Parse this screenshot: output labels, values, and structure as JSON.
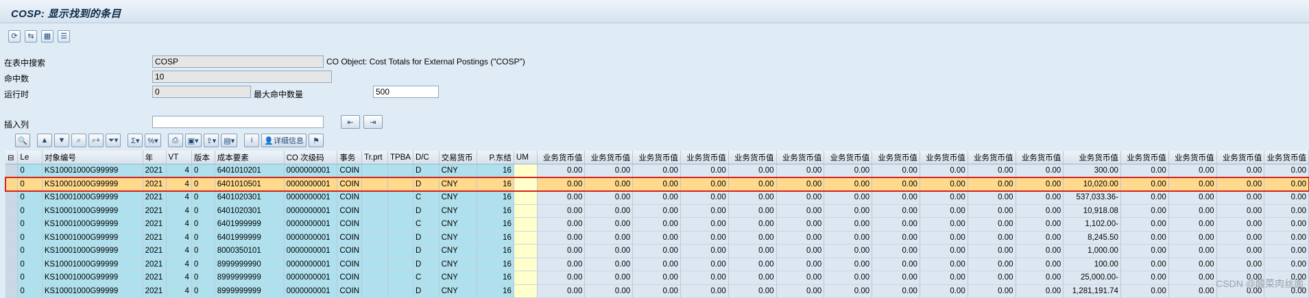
{
  "title": "COSP: 显示找到的条目",
  "toolbar_icons": [
    "refresh-icon",
    "split-icon",
    "table-icon",
    "list-icon"
  ],
  "form": {
    "search_label": "在表中搜索",
    "search_value": "COSP",
    "search_desc": "CO Object: Cost Totals for External Postings (\"COSP\")",
    "hits_label": "命中数",
    "hits_value": "10",
    "runtime_label": "运行时",
    "runtime_value": "0",
    "max_hits_label": "最大命中数量",
    "max_hits_value": "500",
    "insert_col_label": "插入列",
    "insert_col_value": ""
  },
  "alv_toolbar": {
    "detail_label": "详细信息"
  },
  "columns": [
    "Le",
    "对象编号",
    "年",
    "VT",
    "版本",
    "成本要素",
    "CO 次级码",
    "事务",
    "Tr.prt",
    "TPBA",
    "D/C",
    "交易货币",
    "P.东结",
    "UM",
    "业务货币值",
    "业务货币值",
    "业务货币值",
    "业务货币值",
    "业务货币值",
    "业务货币值",
    "业务货币值",
    "业务货币值",
    "业务货币值",
    "业务货币值",
    "业务货币值",
    "业务货币值",
    "业务货币值",
    "业务货币值",
    "业务货币值",
    "业务货币值"
  ],
  "rows": [
    [
      "0",
      "KS10001000G99999",
      "2021",
      "4",
      "0",
      "6401010201",
      "0000000001",
      "COIN",
      "",
      "",
      "D",
      "CNY",
      "16",
      "",
      "0.00",
      "0.00",
      "0.00",
      "0.00",
      "0.00",
      "0.00",
      "0.00",
      "0.00",
      "0.00",
      "0.00",
      "0.00",
      "300.00",
      "0.00",
      "0.00",
      "0.00",
      "0.00"
    ],
    [
      "0",
      "KS10001000G99999",
      "2021",
      "4",
      "0",
      "6401010501",
      "0000000001",
      "COIN",
      "",
      "",
      "D",
      "CNY",
      "16",
      "",
      "0.00",
      "0.00",
      "0.00",
      "0.00",
      "0.00",
      "0.00",
      "0.00",
      "0.00",
      "0.00",
      "0.00",
      "0.00",
      "10,020.00",
      "0.00",
      "0.00",
      "0.00",
      "0.00"
    ],
    [
      "0",
      "KS10001000G99999",
      "2021",
      "4",
      "0",
      "6401020301",
      "0000000001",
      "COIN",
      "",
      "",
      "C",
      "CNY",
      "16",
      "",
      "0.00",
      "0.00",
      "0.00",
      "0.00",
      "0.00",
      "0.00",
      "0.00",
      "0.00",
      "0.00",
      "0.00",
      "0.00",
      "537,033.36-",
      "0.00",
      "0.00",
      "0.00",
      "0.00"
    ],
    [
      "0",
      "KS10001000G99999",
      "2021",
      "4",
      "0",
      "6401020301",
      "0000000001",
      "COIN",
      "",
      "",
      "D",
      "CNY",
      "16",
      "",
      "0.00",
      "0.00",
      "0.00",
      "0.00",
      "0.00",
      "0.00",
      "0.00",
      "0.00",
      "0.00",
      "0.00",
      "0.00",
      "10,918.08",
      "0.00",
      "0.00",
      "0.00",
      "0.00"
    ],
    [
      "0",
      "KS10001000G99999",
      "2021",
      "4",
      "0",
      "6401999999",
      "0000000001",
      "COIN",
      "",
      "",
      "C",
      "CNY",
      "16",
      "",
      "0.00",
      "0.00",
      "0.00",
      "0.00",
      "0.00",
      "0.00",
      "0.00",
      "0.00",
      "0.00",
      "0.00",
      "0.00",
      "1,102.00-",
      "0.00",
      "0.00",
      "0.00",
      "0.00"
    ],
    [
      "0",
      "KS10001000G99999",
      "2021",
      "4",
      "0",
      "6401999999",
      "0000000001",
      "COIN",
      "",
      "",
      "D",
      "CNY",
      "16",
      "",
      "0.00",
      "0.00",
      "0.00",
      "0.00",
      "0.00",
      "0.00",
      "0.00",
      "0.00",
      "0.00",
      "0.00",
      "0.00",
      "8,245.50",
      "0.00",
      "0.00",
      "0.00",
      "0.00"
    ],
    [
      "0",
      "KS10001000G99999",
      "2021",
      "4",
      "0",
      "8000350101",
      "0000000001",
      "COIN",
      "",
      "",
      "D",
      "CNY",
      "16",
      "",
      "0.00",
      "0.00",
      "0.00",
      "0.00",
      "0.00",
      "0.00",
      "0.00",
      "0.00",
      "0.00",
      "0.00",
      "0.00",
      "1,000.00",
      "0.00",
      "0.00",
      "0.00",
      "0.00"
    ],
    [
      "0",
      "KS10001000G99999",
      "2021",
      "4",
      "0",
      "8999999990",
      "0000000001",
      "COIN",
      "",
      "",
      "D",
      "CNY",
      "16",
      "",
      "0.00",
      "0.00",
      "0.00",
      "0.00",
      "0.00",
      "0.00",
      "0.00",
      "0.00",
      "0.00",
      "0.00",
      "0.00",
      "100.00",
      "0.00",
      "0.00",
      "0.00",
      "0.00"
    ],
    [
      "0",
      "KS10001000G99999",
      "2021",
      "4",
      "0",
      "8999999999",
      "0000000001",
      "COIN",
      "",
      "",
      "C",
      "CNY",
      "16",
      "",
      "0.00",
      "0.00",
      "0.00",
      "0.00",
      "0.00",
      "0.00",
      "0.00",
      "0.00",
      "0.00",
      "0.00",
      "0.00",
      "25,000.00-",
      "0.00",
      "0.00",
      "0.00",
      "0.00"
    ],
    [
      "0",
      "KS10001000G99999",
      "2021",
      "4",
      "0",
      "8999999999",
      "0000000001",
      "COIN",
      "",
      "",
      "D",
      "CNY",
      "16",
      "",
      "0.00",
      "0.00",
      "0.00",
      "0.00",
      "0.00",
      "0.00",
      "0.00",
      "0.00",
      "0.00",
      "0.00",
      "0.00",
      "1,281,191.74",
      "0.00",
      "0.00",
      "0.00",
      "0.00"
    ]
  ],
  "highlighted_row": 1,
  "watermark": "CSDN @酸菜肉丝面",
  "colors": {
    "key_col": "#aee0ed",
    "highlight_row": "#ffd98c",
    "highlight_border": "#d6221c",
    "um_col": "#ffffcc"
  }
}
